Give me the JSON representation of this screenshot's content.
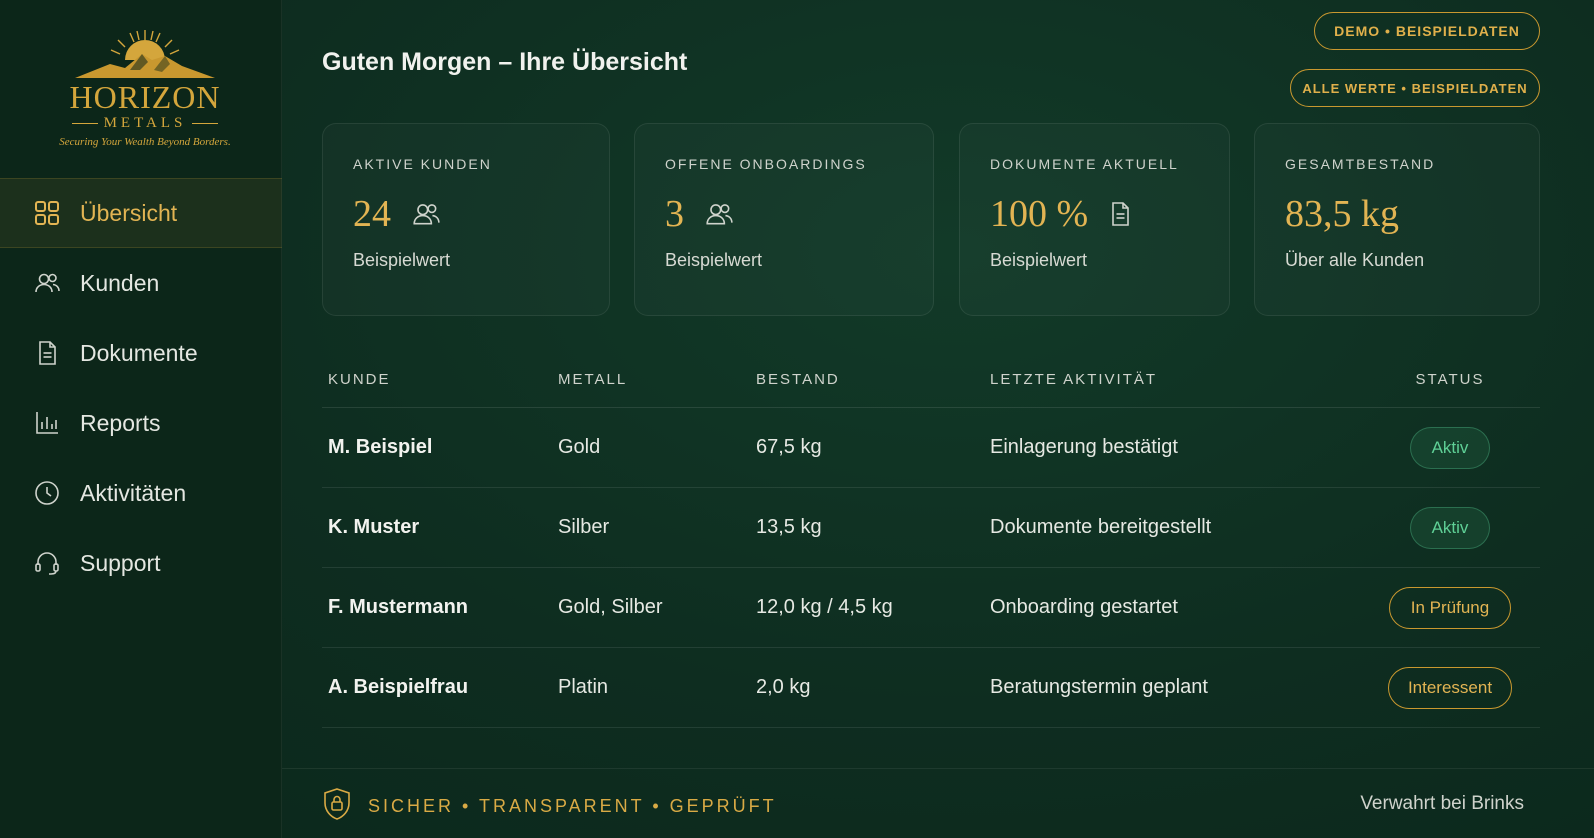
{
  "brand": {
    "name": "HORIZON",
    "sub": "METALS",
    "tagline": "Securing Your Wealth Beyond Borders."
  },
  "sidebar": {
    "items": [
      {
        "label": "Übersicht",
        "icon": "grid-icon",
        "active": true
      },
      {
        "label": "Kunden",
        "icon": "users-icon"
      },
      {
        "label": "Dokumente",
        "icon": "document-icon"
      },
      {
        "label": "Reports",
        "icon": "bar-chart-icon"
      },
      {
        "label": "Aktivitäten",
        "icon": "clock-icon"
      },
      {
        "label": "Support",
        "icon": "headset-icon"
      }
    ]
  },
  "header": {
    "title": "Guten Morgen – Ihre Übersicht",
    "badge_demo": "DEMO • BEISPIELDATEN",
    "badge_values": "ALLE WERTE • BEISPIELDATEN"
  },
  "cards": [
    {
      "label": "AKTIVE KUNDEN",
      "value": "24",
      "icon": "users-icon",
      "note": "Beispielwert"
    },
    {
      "label": "OFFENE ONBOARDINGS",
      "value": "3",
      "icon": "users-icon",
      "note": "Beispielwert"
    },
    {
      "label": "DOKUMENTE AKTUELL",
      "value": "100 %",
      "icon": "document-icon",
      "note": "Beispielwert"
    },
    {
      "label": "GESAMTBESTAND",
      "value": "83,5 kg",
      "icon": "",
      "note": "Über alle Kunden"
    }
  ],
  "table": {
    "headers": [
      "KUNDE",
      "METALL",
      "BESTAND",
      "LETZTE AKTIVITÄT",
      "STATUS"
    ],
    "rows": [
      {
        "kunde": "M. Beispiel",
        "metall": "Gold",
        "bestand": "67,5 kg",
        "aktivitaet": "Einlagerung bestätigt",
        "status": "Aktiv"
      },
      {
        "kunde": "K. Muster",
        "metall": "Silber",
        "bestand": "13,5 kg",
        "aktivitaet": "Dokumente bereitgestellt",
        "status": "Aktiv"
      },
      {
        "kunde": "F. Mustermann",
        "metall": "Gold, Silber",
        "bestand": "12,0 kg / 4,5 kg",
        "aktivitaet": "Onboarding gestartet",
        "status": "In Prüfung"
      },
      {
        "kunde": "A. Beispielfrau",
        "metall": "Platin",
        "bestand": "2,0 kg",
        "aktivitaet": "Beratungstermin geplant",
        "status": "Interessent"
      }
    ]
  },
  "footer": {
    "left": "SICHER • TRANSPARENT • GEPRÜFT",
    "right": "Verwahrt bei Brinks"
  },
  "colors": {
    "background": "#0d2a1e",
    "accent_gold": "#e2b453",
    "status_green": "#5fd096"
  }
}
